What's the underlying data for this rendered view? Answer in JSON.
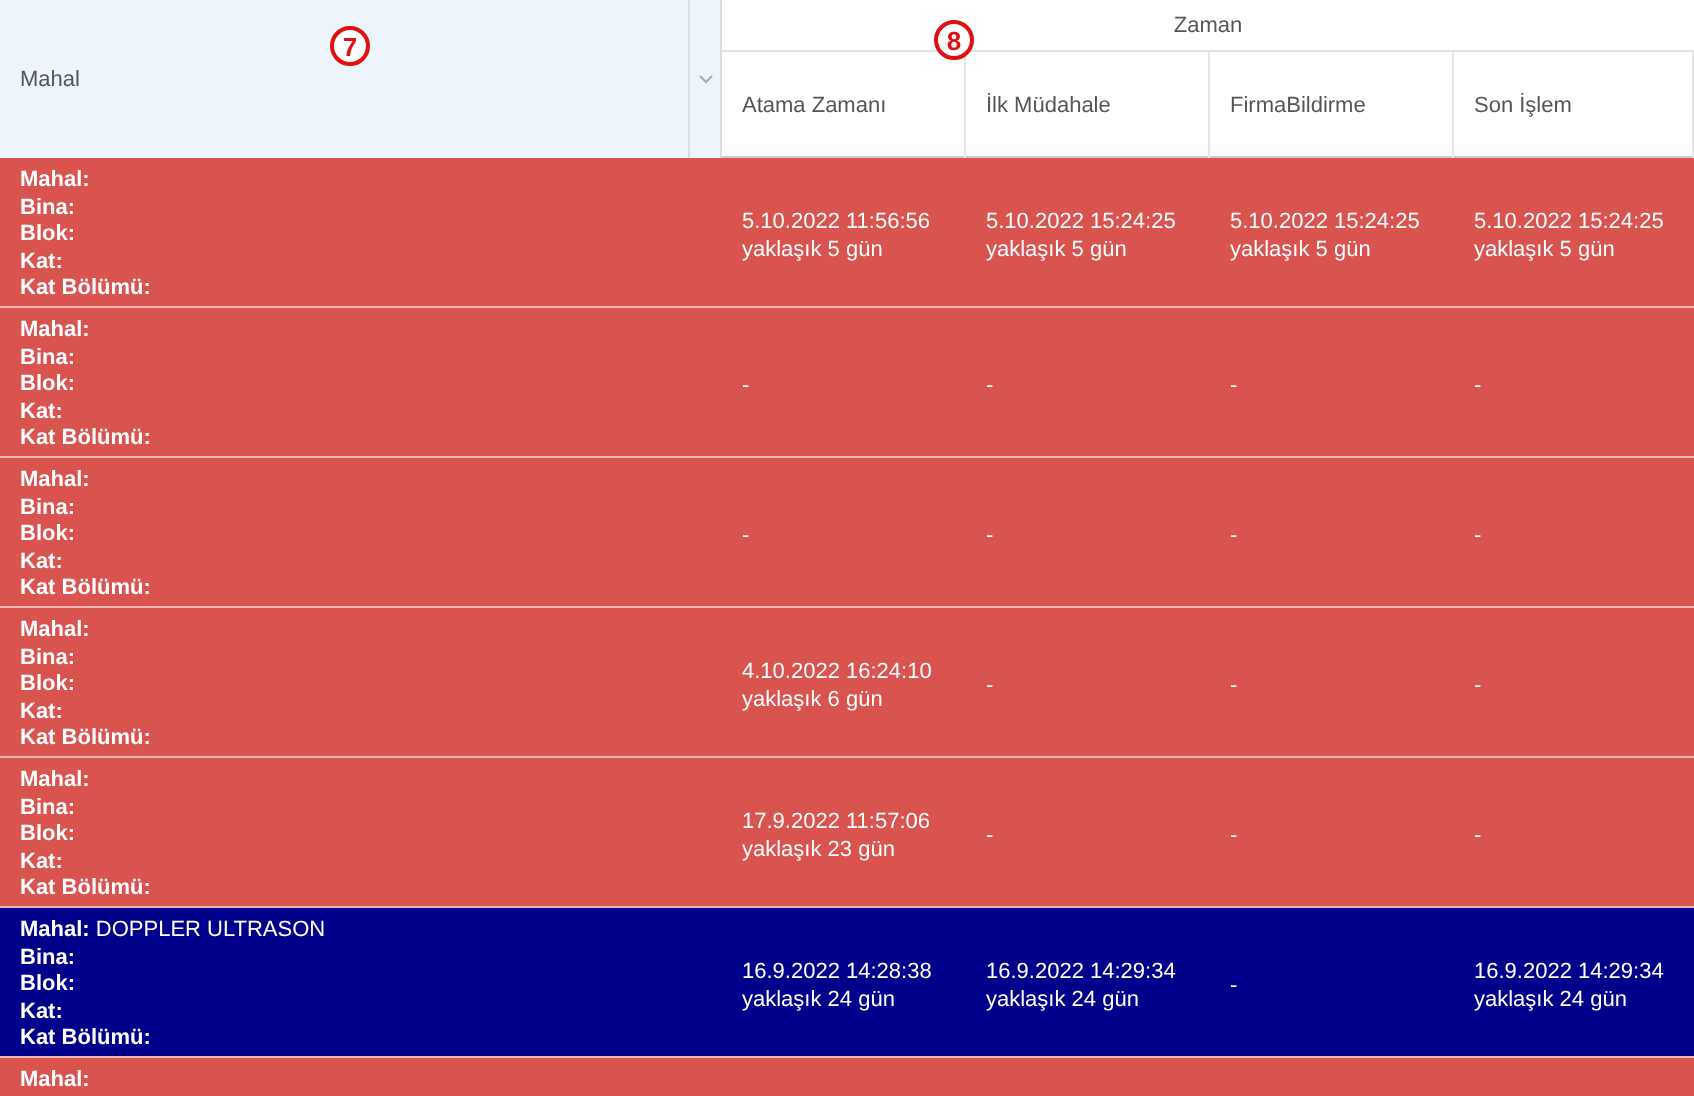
{
  "header": {
    "mahal": "Mahal",
    "group": "Zaman",
    "columns": [
      "Atama Zamanı",
      "İlk Müdahale",
      "FirmaBildirme",
      "Son İşlem"
    ],
    "markers": [
      {
        "text": "7"
      },
      {
        "text": "8"
      }
    ]
  },
  "rows": [
    {
      "selected": false,
      "fields": [
        {
          "label": "Mahal:"
        },
        {
          "label": "Bina:"
        },
        {
          "label": "Blok:"
        },
        {
          "label": "Kat:"
        },
        {
          "label": "Kat Bölümü:"
        }
      ],
      "cells": [
        {
          "time": "5.10.2022 11:56:56",
          "ago": "yaklaşık 5 gün"
        },
        {
          "time": "5.10.2022 15:24:25",
          "ago": "yaklaşık 5 gün"
        },
        {
          "time": "5.10.2022 15:24:25",
          "ago": "yaklaşık 5 gün"
        },
        {
          "time": "5.10.2022 15:24:25",
          "ago": "yaklaşık 5 gün"
        }
      ]
    },
    {
      "selected": false,
      "fields": [
        {
          "label": "Mahal:"
        },
        {
          "label": "Bina:"
        },
        {
          "label": "Blok:"
        },
        {
          "label": "Kat:"
        },
        {
          "label": "Kat Bölümü:"
        }
      ],
      "cells": [
        {
          "time": "-"
        },
        {
          "time": "-"
        },
        {
          "time": "-"
        },
        {
          "time": "-"
        }
      ]
    },
    {
      "selected": false,
      "fields": [
        {
          "label": "Mahal:"
        },
        {
          "label": "Bina:"
        },
        {
          "label": "Blok:"
        },
        {
          "label": "Kat:"
        },
        {
          "label": "Kat Bölümü:"
        }
      ],
      "cells": [
        {
          "time": "-"
        },
        {
          "time": "-"
        },
        {
          "time": "-"
        },
        {
          "time": "-"
        }
      ]
    },
    {
      "selected": false,
      "fields": [
        {
          "label": "Mahal:"
        },
        {
          "label": "Bina:"
        },
        {
          "label": "Blok:"
        },
        {
          "label": "Kat:"
        },
        {
          "label": "Kat Bölümü:"
        }
      ],
      "cells": [
        {
          "time": "4.10.2022 16:24:10",
          "ago": "yaklaşık 6 gün"
        },
        {
          "time": "-"
        },
        {
          "time": "-"
        },
        {
          "time": "-"
        }
      ]
    },
    {
      "selected": false,
      "fields": [
        {
          "label": "Mahal:"
        },
        {
          "label": "Bina:"
        },
        {
          "label": "Blok:"
        },
        {
          "label": "Kat:"
        },
        {
          "label": "Kat Bölümü:"
        }
      ],
      "cells": [
        {
          "time": "17.9.2022 11:57:06",
          "ago": "yaklaşık 23 gün"
        },
        {
          "time": "-"
        },
        {
          "time": "-"
        },
        {
          "time": "-"
        }
      ]
    },
    {
      "selected": true,
      "fields": [
        {
          "label": "Mahal:",
          "value": "DOPPLER ULTRASON"
        },
        {
          "label": "Bina:"
        },
        {
          "label": "Blok:"
        },
        {
          "label": "Kat:"
        },
        {
          "label": "Kat Bölümü:"
        }
      ],
      "cells": [
        {
          "time": "16.9.2022 14:28:38",
          "ago": "yaklaşık 24 gün"
        },
        {
          "time": "16.9.2022 14:29:34",
          "ago": "yaklaşık 24 gün"
        },
        {
          "time": "-"
        },
        {
          "time": "16.9.2022 14:29:34",
          "ago": "yaklaşık 24 gün"
        }
      ]
    },
    {
      "selected": false,
      "fields": [
        {
          "label": "Mahal:"
        }
      ],
      "cells": []
    }
  ]
}
